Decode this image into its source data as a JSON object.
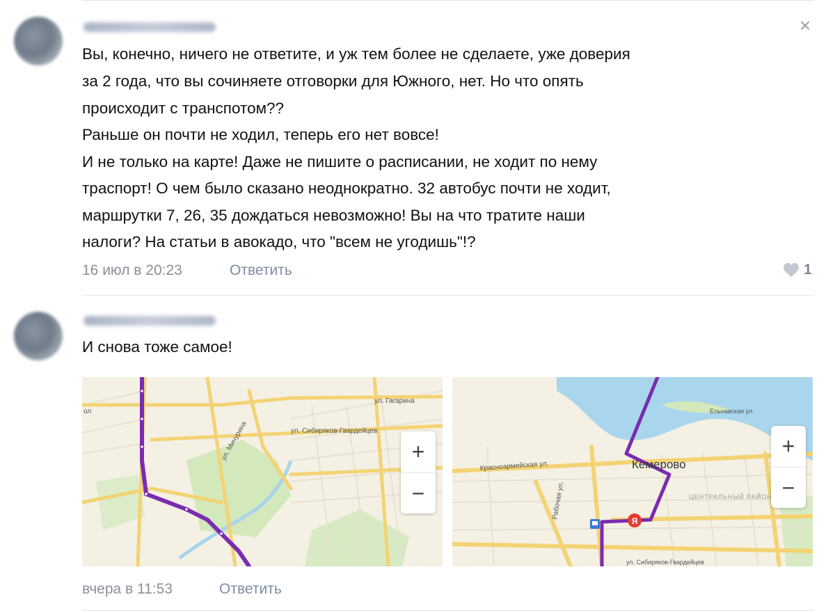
{
  "comments": [
    {
      "lines": [
        "Вы, конечно, ничего не ответите, и уж тем более не сделаете, уже доверия",
        "за 2 года, что вы сочиняете отговорки для Южного, нет. Но что опять",
        "происходит с транспотом??",
        "Раньше он почти не ходил, теперь его нет вовсе!",
        "И не только на карте! Даже не пишите о расписании, не ходит по нему",
        "траспорт! О чем было сказано неоднократно. 32 автобус почти не ходит,",
        "маршрутки 7, 26, 35 дождаться невозможно! Вы на что тратите наши",
        "налоги? На статьи в авокадо, что \"всем не угодишь\"!?"
      ],
      "time": "16 июл в 20:23",
      "reply_label": "Ответить",
      "like_count": "1",
      "close_icon": "×"
    },
    {
      "text": "И снова тоже самое!",
      "time": "вчера в 11:53",
      "reply_label": "Ответить",
      "maps": [
        {
          "labels": [
            "ул. Гагарина",
            "ул. Сибиряков-Гвардейцев",
            "ул. Мичурина",
            "ол"
          ],
          "zoom_in": "+",
          "zoom_out": "−"
        },
        {
          "labels": [
            "Кемерово",
            "Красноармейская ул.",
            "ЦЕНТРАЛЬНЫЙ РАЙОН",
            "Рабочая ул.",
            "Ельнавская ул.",
            "ул. Сибиряков-Гвардейцев",
            "Я"
          ],
          "zoom_in": "+",
          "zoom_out": "−"
        }
      ]
    }
  ],
  "colors": {
    "route": "#7b2bb0",
    "road": "#f2cf6c",
    "river": "#9fd0ea",
    "park": "#cfe7b4",
    "link": "#7d8da3"
  },
  "icons": [
    "close-icon",
    "heart-icon",
    "yandex-marker-icon",
    "bus-stop-icon"
  ]
}
